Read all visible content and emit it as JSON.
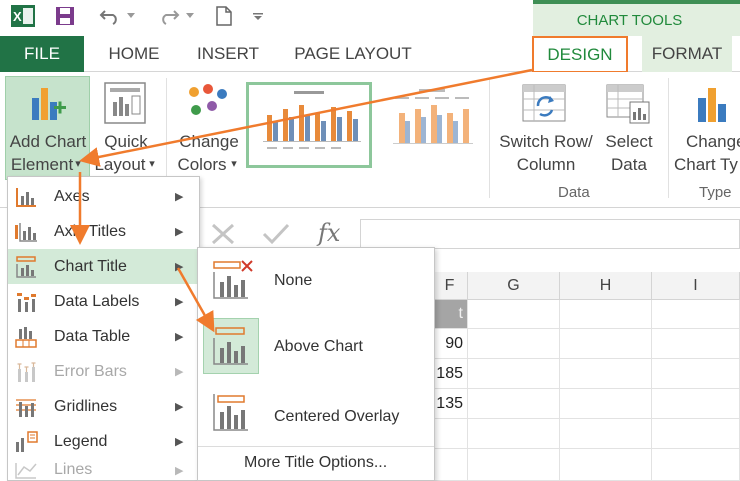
{
  "titlebar": {
    "contextual_group": "CHART TOOLS"
  },
  "tabs": {
    "file": "FILE",
    "home": "HOME",
    "insert": "INSERT",
    "page_layout": "PAGE LAYOUT",
    "design": "DESIGN",
    "format": "FORMAT"
  },
  "ribbon": {
    "add_chart_element": [
      "Add Chart",
      "Element"
    ],
    "quick_layout": [
      "Quick",
      "Layout"
    ],
    "change_colors": [
      "Change",
      "Colors"
    ],
    "switch_row_column": [
      "Switch Row/",
      "Column"
    ],
    "select_data": [
      "Select",
      "Data"
    ],
    "change_chart_type": [
      "Change",
      "Chart Ty"
    ],
    "groups": {
      "data": "Data",
      "type": "Type"
    },
    "dropdown_glyph": "▾"
  },
  "grid": {
    "columns": [
      "F",
      "G",
      "H",
      "I"
    ],
    "header_partial": "t",
    "values": [
      "90",
      "185",
      "135"
    ]
  },
  "menu": {
    "items": [
      {
        "label": "Axes",
        "icon": "axes-icon",
        "enabled": true
      },
      {
        "label": "Axis Titles",
        "icon": "axis-titles-icon",
        "enabled": true
      },
      {
        "label": "Chart Title",
        "icon": "chart-title-icon",
        "enabled": true,
        "active": true
      },
      {
        "label": "Data Labels",
        "icon": "data-labels-icon",
        "enabled": true
      },
      {
        "label": "Data Table",
        "icon": "data-table-icon",
        "enabled": true
      },
      {
        "label": "Error Bars",
        "icon": "error-bars-icon",
        "enabled": false
      },
      {
        "label": "Gridlines",
        "icon": "gridlines-icon",
        "enabled": true
      },
      {
        "label": "Legend",
        "icon": "legend-icon",
        "enabled": true
      },
      {
        "label": "Lines",
        "icon": "lines-icon",
        "enabled": false
      }
    ],
    "submenu_arrow": "▶"
  },
  "submenu": {
    "items": [
      {
        "label": "None",
        "icon": "no-title-icon"
      },
      {
        "label": "Above Chart",
        "icon": "above-chart-icon",
        "selected": true
      },
      {
        "label": "Centered Overlay",
        "icon": "centered-overlay-icon"
      }
    ],
    "more_options": "More Title Options..."
  },
  "colors": {
    "excel_green": "#217346",
    "accent_orange": "#f07b2d",
    "highlight_green": "#d3ead8",
    "chart_tools_green": "#218a3c"
  }
}
